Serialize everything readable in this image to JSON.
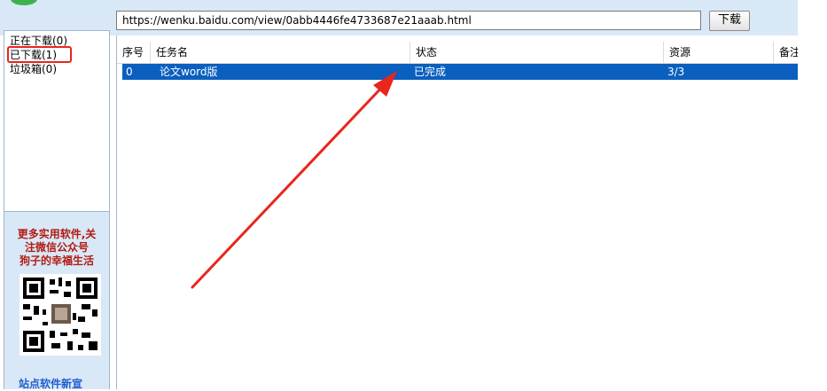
{
  "toolbar": {
    "url_value": "https://wenku.baidu.com/view/0abb4446fe4733687e21aaab.html",
    "download_label": "下载"
  },
  "sidebar": {
    "items": [
      {
        "label": "正在下载(0)"
      },
      {
        "label": "已下载(1)"
      },
      {
        "label": "垃圾箱(0)"
      }
    ],
    "selected_index": 1
  },
  "promo": {
    "lines": [
      "更多实用软件,关",
      "注微信公众号",
      "狗子的幸福生活"
    ],
    "bottom_label": "站点软件新宣"
  },
  "table": {
    "columns": [
      "序号",
      "任务名",
      "状态",
      "资源",
      "备注"
    ],
    "rows": [
      {
        "index": "0",
        "name": "论文word版",
        "status": "已完成",
        "source": "3/3",
        "note": ""
      }
    ]
  },
  "colors": {
    "selection": "#0a5fbf",
    "annotation": "#e8261c",
    "promo_text": "#b21b12"
  }
}
